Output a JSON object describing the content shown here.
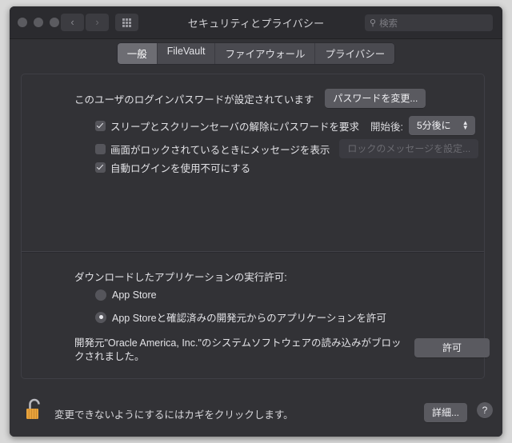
{
  "window": {
    "title": "セキュリティとプライバシー",
    "traffic_lights": [
      "close",
      "minimize",
      "zoom"
    ],
    "nav": {
      "back": "‹",
      "forward": "›"
    },
    "grid_button": "grid-icon",
    "search": {
      "icon": "search-icon",
      "placeholder": "検索",
      "value": ""
    }
  },
  "tabs": [
    {
      "label": "一般",
      "active": true
    },
    {
      "label": "FileVault",
      "active": false
    },
    {
      "label": "ファイアウォール",
      "active": false
    },
    {
      "label": "プライバシー",
      "active": false
    }
  ],
  "general": {
    "password_status": "このユーザのログインパスワードが設定されています",
    "change_password_button": "パスワードを変更...",
    "require_password": {
      "label": "スリープとスクリーンセーバの解除にパスワードを要求",
      "checked": true,
      "delay_label": "開始後:",
      "delay_value": "5分後に"
    },
    "show_message": {
      "label": "画面がロックされているときにメッセージを表示",
      "checked": false,
      "set_message_button": "ロックのメッセージを設定...",
      "button_disabled": true
    },
    "disable_auto_login": {
      "label": "自動ログインを使用不可にする",
      "checked": true
    }
  },
  "gatekeeper": {
    "title": "ダウンロードしたアプリケーションの実行許可:",
    "options": [
      {
        "label": "App Store",
        "selected": false
      },
      {
        "label": "App Storeと確認済みの開発元からのアプリケーションを許可",
        "selected": true
      }
    ]
  },
  "blocked_notice": {
    "message": "開発元\"Oracle America, Inc.\"のシステムソフトウェアの読み込みがブロックされました。",
    "allow_button": "許可"
  },
  "footer": {
    "lock_icon": "unlocked-padlock-icon",
    "text": "変更できないようにするにはカギをクリックします。",
    "advanced_button": "詳細...",
    "help_button": "?"
  },
  "colors": {
    "window_bg": "#323236",
    "toolbar_bg": "#2b2b2f",
    "button_bg": "#5a5a60",
    "active_tab": "#6d6d73",
    "lock_gold": "#e8a33d"
  }
}
